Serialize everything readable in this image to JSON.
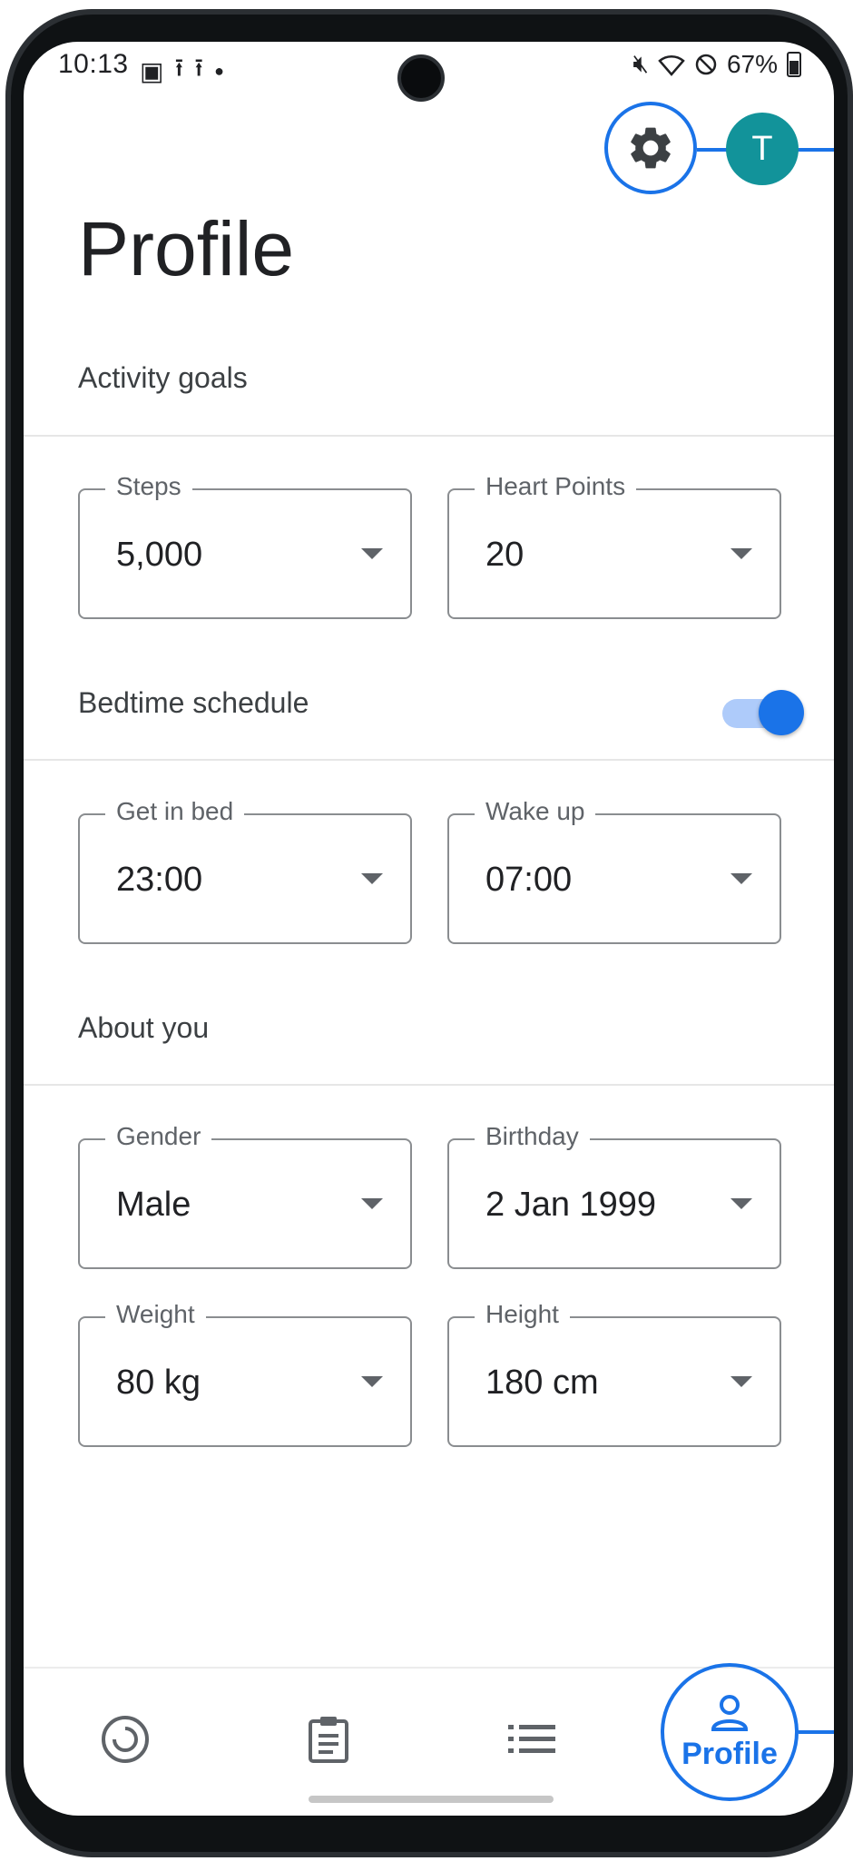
{
  "status_bar": {
    "time": "10:13",
    "battery": "67%"
  },
  "page": {
    "title": "Profile"
  },
  "sections": {
    "activity_goals": "Activity goals",
    "bedtime_schedule": "Bedtime schedule",
    "about_you": "About you"
  },
  "fields": {
    "steps": {
      "label": "Steps",
      "value": "5,000"
    },
    "heart_points": {
      "label": "Heart Points",
      "value": "20"
    },
    "get_in_bed": {
      "label": "Get in bed",
      "value": "23:00"
    },
    "wake_up": {
      "label": "Wake up",
      "value": "07:00"
    },
    "gender": {
      "label": "Gender",
      "value": "Male"
    },
    "birthday": {
      "label": "Birthday",
      "value": "2 Jan 1999"
    },
    "weight": {
      "label": "Weight",
      "value": "80 kg"
    },
    "height": {
      "label": "Height",
      "value": "180 cm"
    }
  },
  "bedtime_toggle": {
    "on": true
  },
  "avatar": {
    "initial": "T",
    "color": "#12939a"
  },
  "bottom_nav": {
    "items": [
      "home",
      "journal",
      "browse",
      "Profile"
    ],
    "active_label": "Profile"
  },
  "colors": {
    "accent": "#1a73e8"
  }
}
